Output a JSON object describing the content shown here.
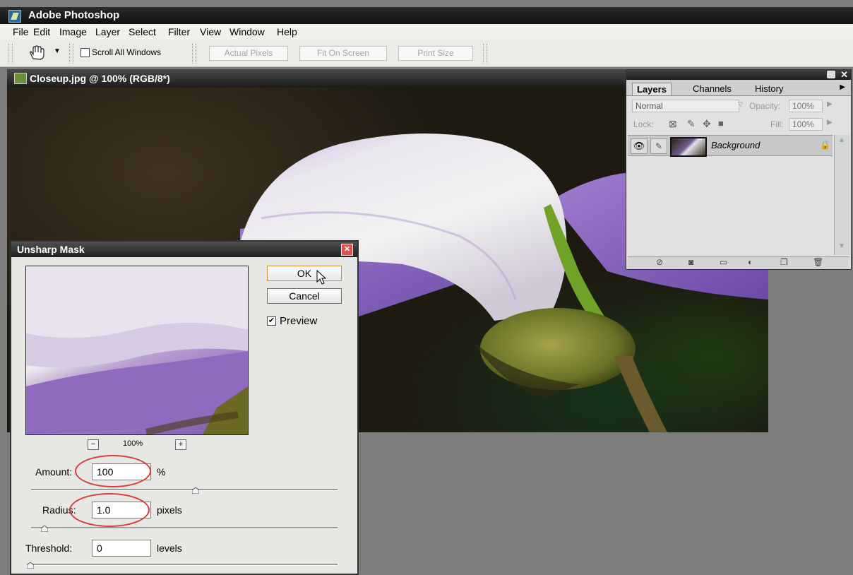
{
  "app": {
    "title": "Adobe Photoshop"
  },
  "menu": [
    "File",
    "Edit",
    "Image",
    "Layer",
    "Select",
    "Filter",
    "View",
    "Window",
    "Help"
  ],
  "toolbar": {
    "scroll_all_label": "Scroll All Windows",
    "actual_pixels": "Actual Pixels",
    "fit_on_screen": "Fit On Screen",
    "print_size": "Print Size"
  },
  "document": {
    "title": "Closeup.jpg @ 100% (RGB/8*)"
  },
  "layers_panel": {
    "tabs": [
      "Layers",
      "Channels",
      "History"
    ],
    "blend_mode": "Normal",
    "opacity_label": "Opacity:",
    "opacity_value": "100%",
    "lock_label": "Lock:",
    "fill_label": "Fill:",
    "fill_value": "100%",
    "layer_name": "Background"
  },
  "dialog": {
    "title": "Unsharp Mask",
    "ok_label": "OK",
    "cancel_label": "Cancel",
    "preview_label": "Preview",
    "zoom_value": "100%",
    "zoom_minus": "−",
    "zoom_plus": "+",
    "amount_label": "Amount:",
    "amount_value": "100",
    "amount_unit": "%",
    "radius_label": "Radius:",
    "radius_value": "1.0",
    "radius_unit": "pixels",
    "threshold_label": "Threshold:",
    "threshold_value": "0",
    "threshold_unit": "levels"
  },
  "colors": {
    "highlight_ring": "#d93b3b",
    "titlebar": "#1b1b1b"
  }
}
